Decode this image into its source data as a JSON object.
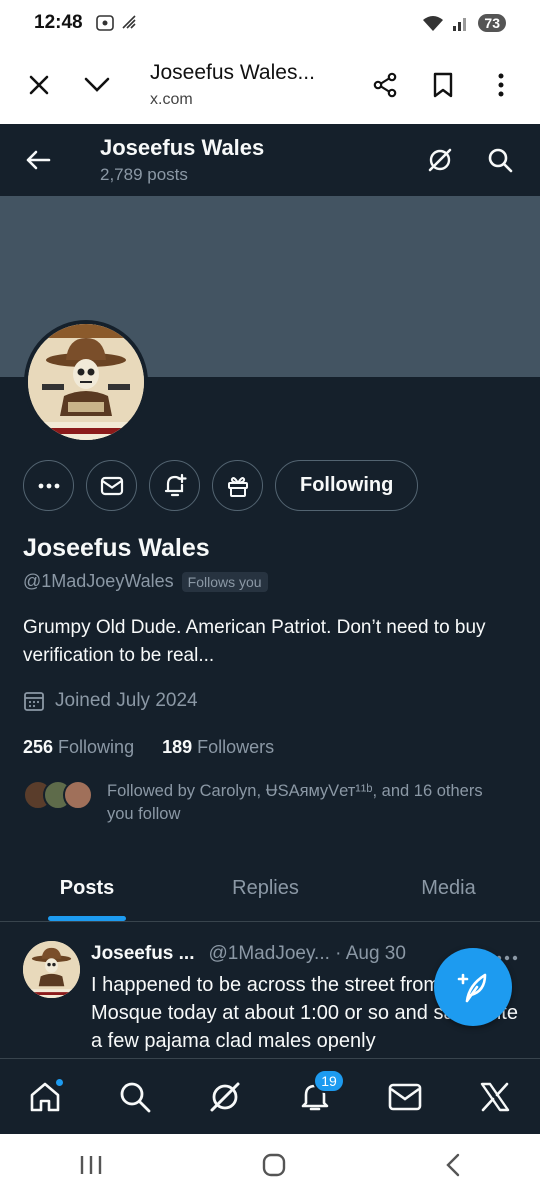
{
  "status_bar": {
    "time": "12:48",
    "battery": "73"
  },
  "browser": {
    "title": "Joseefus Wales...",
    "url": "x.com"
  },
  "header": {
    "name": "Joseefus Wales",
    "posts_count": "2,789 posts"
  },
  "profile": {
    "name": "Joseefus Wales",
    "handle": "@1MadJoeyWales",
    "follows_you": "Follows you",
    "following_button": "Following",
    "bio": "Grumpy Old Dude. American Patriot. Don’t need to buy verification to be real...",
    "joined": "Joined July 2024",
    "following_count": "256",
    "following_label": "Following",
    "followers_count": "189",
    "followers_label": "Followers",
    "followed_by": "Followed by Carolyn, ɄSAямyVет¹¹ᵇ, and 16 others you follow"
  },
  "tabs": [
    {
      "label": "Posts",
      "active": true
    },
    {
      "label": "Replies",
      "active": false
    },
    {
      "label": "Media",
      "active": false
    }
  ],
  "tweet": {
    "name": "Joseefus ...",
    "meta": "@1MadJoey... · Aug 30",
    "text": "I happened to be across the street from a Mosque today at about 1:00 or so and saw quite a few pajama clad males openly"
  },
  "bottom_nav": {
    "notifications_badge": "19"
  },
  "colors": {
    "background": "#15202b",
    "accent": "#1d9bf0",
    "banner": "#435462",
    "muted": "#8b98a5"
  }
}
